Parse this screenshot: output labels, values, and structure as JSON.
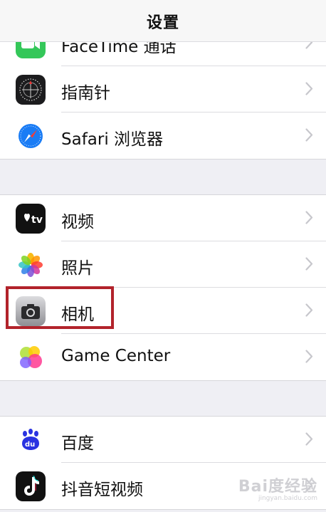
{
  "navbar": {
    "title": "设置"
  },
  "group1": {
    "items": [
      {
        "label": "FaceTime 通话",
        "icon": "facetime-icon",
        "color": "#34c759"
      },
      {
        "label": "指南针",
        "icon": "compass-icon",
        "color": "#1c1c1e"
      },
      {
        "label": "Safari 浏览器",
        "icon": "safari-icon",
        "color": "#1a7cf5"
      }
    ]
  },
  "group2": {
    "items": [
      {
        "label": "视频",
        "icon": "tv-icon",
        "color": "#111111"
      },
      {
        "label": "照片",
        "icon": "photos-icon",
        "color": "#ffffff"
      },
      {
        "label": "相机",
        "icon": "camera-icon",
        "color": "#8e8e93"
      },
      {
        "label": "Game Center",
        "icon": "game-center-icon",
        "color": "#ffffff"
      }
    ]
  },
  "group3": {
    "items": [
      {
        "label": "百度",
        "icon": "baidu-icon",
        "color": "#2932e1"
      },
      {
        "label": "抖音短视频",
        "icon": "douyin-icon",
        "color": "#111111"
      }
    ]
  },
  "highlight_color": "#b2232b",
  "watermark": {
    "brand": "Bai度经验",
    "url": "jingyan.baidu.com"
  }
}
